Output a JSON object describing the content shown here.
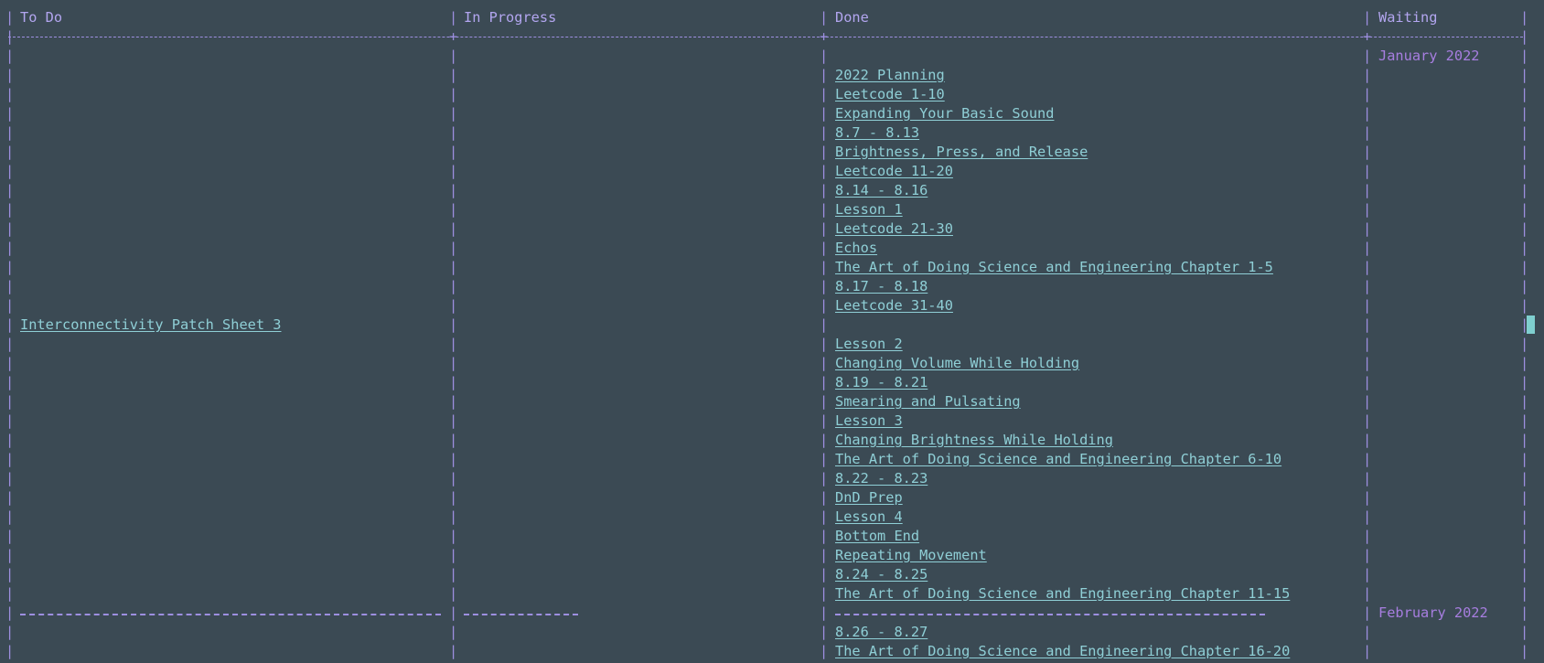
{
  "board": {
    "headers": [
      "To Do",
      "In Progress",
      "Done",
      "Waiting"
    ],
    "todo_items": [
      {
        "row": 16,
        "text": "Interconnectivity Patch Sheet 3"
      }
    ],
    "in_progress_items": [],
    "done_items": [
      {
        "row": 3,
        "text": "2022 Planning"
      },
      {
        "row": 4,
        "text": "Leetcode 1-10"
      },
      {
        "row": 5,
        "text": "Expanding Your Basic Sound"
      },
      {
        "row": 6,
        "text": "8.7 - 8.13"
      },
      {
        "row": 7,
        "text": "Brightness, Press, and Release"
      },
      {
        "row": 8,
        "text": "Leetcode 11-20"
      },
      {
        "row": 9,
        "text": "8.14 - 8.16"
      },
      {
        "row": 10,
        "text": "Lesson 1"
      },
      {
        "row": 11,
        "text": "Leetcode 21-30"
      },
      {
        "row": 12,
        "text": "Echos"
      },
      {
        "row": 13,
        "text": "The Art of Doing Science and Engineering Chapter 1-5"
      },
      {
        "row": 14,
        "text": "8.17 - 8.18"
      },
      {
        "row": 15,
        "text": "Leetcode 31-40"
      },
      {
        "row": 17,
        "text": "Lesson 2"
      },
      {
        "row": 18,
        "text": "Changing Volume While Holding"
      },
      {
        "row": 19,
        "text": "8.19 - 8.21"
      },
      {
        "row": 20,
        "text": "Smearing and Pulsating"
      },
      {
        "row": 21,
        "text": "Lesson 3"
      },
      {
        "row": 22,
        "text": "Changing Brightness While Holding"
      },
      {
        "row": 23,
        "text": "The Art of Doing Science and Engineering Chapter 6-10"
      },
      {
        "row": 24,
        "text": "8.22 - 8.23"
      },
      {
        "row": 25,
        "text": "DnD Prep"
      },
      {
        "row": 26,
        "text": "Lesson 4"
      },
      {
        "row": 27,
        "text": "Bottom End"
      },
      {
        "row": 28,
        "text": "Repeating Movement"
      },
      {
        "row": 29,
        "text": "8.24 - 8.25"
      },
      {
        "row": 30,
        "text": "The Art of Doing Science and Engineering Chapter 11-15"
      },
      {
        "row": 32,
        "text": "8.26 - 8.27"
      },
      {
        "row": 33,
        "text": "The Art of Doing Science and Engineering Chapter 16-20"
      }
    ],
    "waiting_items": [
      {
        "row": 2,
        "text": "January 2022"
      },
      {
        "row": 31,
        "text": "February 2022"
      }
    ],
    "separator_row": 31
  },
  "colors": {
    "background": "#3b4a54",
    "border": "#9d8fe0",
    "header": "#b3a6f0",
    "link": "#8fcfd6",
    "month": "#a77ee0",
    "cursor": "#7fcfcf"
  }
}
